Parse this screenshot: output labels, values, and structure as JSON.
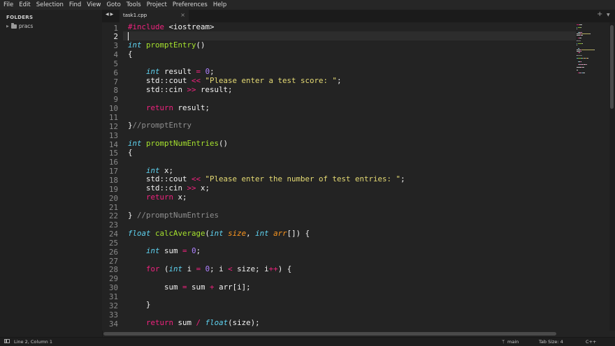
{
  "menu": [
    "File",
    "Edit",
    "Selection",
    "Find",
    "View",
    "Goto",
    "Tools",
    "Project",
    "Preferences",
    "Help"
  ],
  "sidebar": {
    "title": "FOLDERS",
    "folders": [
      {
        "name": "pracs"
      }
    ]
  },
  "tabs": [
    {
      "label": "task1.cpp",
      "active": true
    }
  ],
  "editor": {
    "current_line": 2,
    "lines": [
      [
        {
          "t": "#include ",
          "c": "#f0227e"
        },
        {
          "t": "<iostream>",
          "c": "#f2f2f2"
        }
      ],
      [],
      [
        {
          "t": "int",
          "c": "#5fd4f2",
          "i": true
        },
        {
          "t": " ",
          "c": "#f2f2f2"
        },
        {
          "t": "promptEntry",
          "c": "#a6e22e"
        },
        {
          "t": "()",
          "c": "#f2f2f2"
        }
      ],
      [
        {
          "t": "{",
          "c": "#f2f2f2"
        }
      ],
      [],
      [
        {
          "t": "    ",
          "c": "#f2f2f2"
        },
        {
          "t": "int",
          "c": "#5fd4f2",
          "i": true
        },
        {
          "t": " result ",
          "c": "#f2f2f2"
        },
        {
          "t": "=",
          "c": "#f0227e"
        },
        {
          "t": " ",
          "c": "#f2f2f2"
        },
        {
          "t": "0",
          "c": "#ae81ff"
        },
        {
          "t": ";",
          "c": "#f2f2f2"
        }
      ],
      [
        {
          "t": "    std::cout ",
          "c": "#f2f2f2"
        },
        {
          "t": "<<",
          "c": "#f0227e"
        },
        {
          "t": " ",
          "c": "#f2f2f2"
        },
        {
          "t": "\"Please enter a test score: \"",
          "c": "#e6db74"
        },
        {
          "t": ";",
          "c": "#f2f2f2"
        }
      ],
      [
        {
          "t": "    std::cin ",
          "c": "#f2f2f2"
        },
        {
          "t": ">>",
          "c": "#f0227e"
        },
        {
          "t": " result;",
          "c": "#f2f2f2"
        }
      ],
      [],
      [
        {
          "t": "    ",
          "c": "#f2f2f2"
        },
        {
          "t": "return",
          "c": "#f0227e"
        },
        {
          "t": " result;",
          "c": "#f2f2f2"
        }
      ],
      [],
      [
        {
          "t": "}",
          "c": "#f2f2f2"
        },
        {
          "t": "//promptEntry",
          "c": "#8f8f8f"
        }
      ],
      [],
      [
        {
          "t": "int",
          "c": "#5fd4f2",
          "i": true
        },
        {
          "t": " ",
          "c": "#f2f2f2"
        },
        {
          "t": "promptNumEntries",
          "c": "#a6e22e"
        },
        {
          "t": "()",
          "c": "#f2f2f2"
        }
      ],
      [
        {
          "t": "{",
          "c": "#f2f2f2"
        }
      ],
      [],
      [
        {
          "t": "    ",
          "c": "#f2f2f2"
        },
        {
          "t": "int",
          "c": "#5fd4f2",
          "i": true
        },
        {
          "t": " x;",
          "c": "#f2f2f2"
        }
      ],
      [
        {
          "t": "    std::cout ",
          "c": "#f2f2f2"
        },
        {
          "t": "<<",
          "c": "#f0227e"
        },
        {
          "t": " ",
          "c": "#f2f2f2"
        },
        {
          "t": "\"Please enter the number of test entries: \"",
          "c": "#e6db74"
        },
        {
          "t": ";",
          "c": "#f2f2f2"
        }
      ],
      [
        {
          "t": "    std::cin ",
          "c": "#f2f2f2"
        },
        {
          "t": ">>",
          "c": "#f0227e"
        },
        {
          "t": " x;",
          "c": "#f2f2f2"
        }
      ],
      [
        {
          "t": "    ",
          "c": "#f2f2f2"
        },
        {
          "t": "return",
          "c": "#f0227e"
        },
        {
          "t": " x;",
          "c": "#f2f2f2"
        }
      ],
      [],
      [
        {
          "t": "} ",
          "c": "#f2f2f2"
        },
        {
          "t": "//promptNumEntries",
          "c": "#8f8f8f"
        }
      ],
      [],
      [
        {
          "t": "float",
          "c": "#5fd4f2",
          "i": true
        },
        {
          "t": " ",
          "c": "#f2f2f2"
        },
        {
          "t": "calcAverage",
          "c": "#a6e22e"
        },
        {
          "t": "(",
          "c": "#f2f2f2"
        },
        {
          "t": "int",
          "c": "#5fd4f2",
          "i": true
        },
        {
          "t": " ",
          "c": "#f2f2f2"
        },
        {
          "t": "size",
          "c": "#fd971f",
          "i": true
        },
        {
          "t": ", ",
          "c": "#f2f2f2"
        },
        {
          "t": "int",
          "c": "#5fd4f2",
          "i": true
        },
        {
          "t": " ",
          "c": "#f2f2f2"
        },
        {
          "t": "arr",
          "c": "#fd971f",
          "i": true
        },
        {
          "t": "[]) {",
          "c": "#f2f2f2"
        }
      ],
      [],
      [
        {
          "t": "    ",
          "c": "#f2f2f2"
        },
        {
          "t": "int",
          "c": "#5fd4f2",
          "i": true
        },
        {
          "t": " sum ",
          "c": "#f2f2f2"
        },
        {
          "t": "=",
          "c": "#f0227e"
        },
        {
          "t": " ",
          "c": "#f2f2f2"
        },
        {
          "t": "0",
          "c": "#ae81ff"
        },
        {
          "t": ";",
          "c": "#f2f2f2"
        }
      ],
      [],
      [
        {
          "t": "    ",
          "c": "#f2f2f2"
        },
        {
          "t": "for",
          "c": "#f0227e"
        },
        {
          "t": " (",
          "c": "#f2f2f2"
        },
        {
          "t": "int",
          "c": "#5fd4f2",
          "i": true
        },
        {
          "t": " i ",
          "c": "#f2f2f2"
        },
        {
          "t": "=",
          "c": "#f0227e"
        },
        {
          "t": " ",
          "c": "#f2f2f2"
        },
        {
          "t": "0",
          "c": "#ae81ff"
        },
        {
          "t": "; i ",
          "c": "#f2f2f2"
        },
        {
          "t": "<",
          "c": "#f0227e"
        },
        {
          "t": " size; i",
          "c": "#f2f2f2"
        },
        {
          "t": "++",
          "c": "#f0227e"
        },
        {
          "t": ") {",
          "c": "#f2f2f2"
        }
      ],
      [],
      [
        {
          "t": "        sum ",
          "c": "#f2f2f2"
        },
        {
          "t": "=",
          "c": "#f0227e"
        },
        {
          "t": " sum ",
          "c": "#f2f2f2"
        },
        {
          "t": "+",
          "c": "#f0227e"
        },
        {
          "t": " arr[i];",
          "c": "#f2f2f2"
        }
      ],
      [],
      [
        {
          "t": "    }",
          "c": "#f2f2f2"
        }
      ],
      [],
      [
        {
          "t": "    ",
          "c": "#f2f2f2"
        },
        {
          "t": "return",
          "c": "#f0227e"
        },
        {
          "t": " sum ",
          "c": "#f2f2f2"
        },
        {
          "t": "/",
          "c": "#f0227e"
        },
        {
          "t": " ",
          "c": "#f2f2f2"
        },
        {
          "t": "float",
          "c": "#5fd4f2",
          "i": true
        },
        {
          "t": "(size);",
          "c": "#f2f2f2"
        }
      ]
    ]
  },
  "status": {
    "position": "Line 2, Column 1",
    "branch": "main",
    "tab_size": "Tab Size: 4",
    "syntax": "C++"
  },
  "colors": {
    "keyword": "#f0227e",
    "type": "#5fd4f2",
    "function": "#a6e22e",
    "string": "#e6db74",
    "number": "#ae81ff",
    "param": "#fd971f",
    "comment": "#8f8f8f"
  }
}
